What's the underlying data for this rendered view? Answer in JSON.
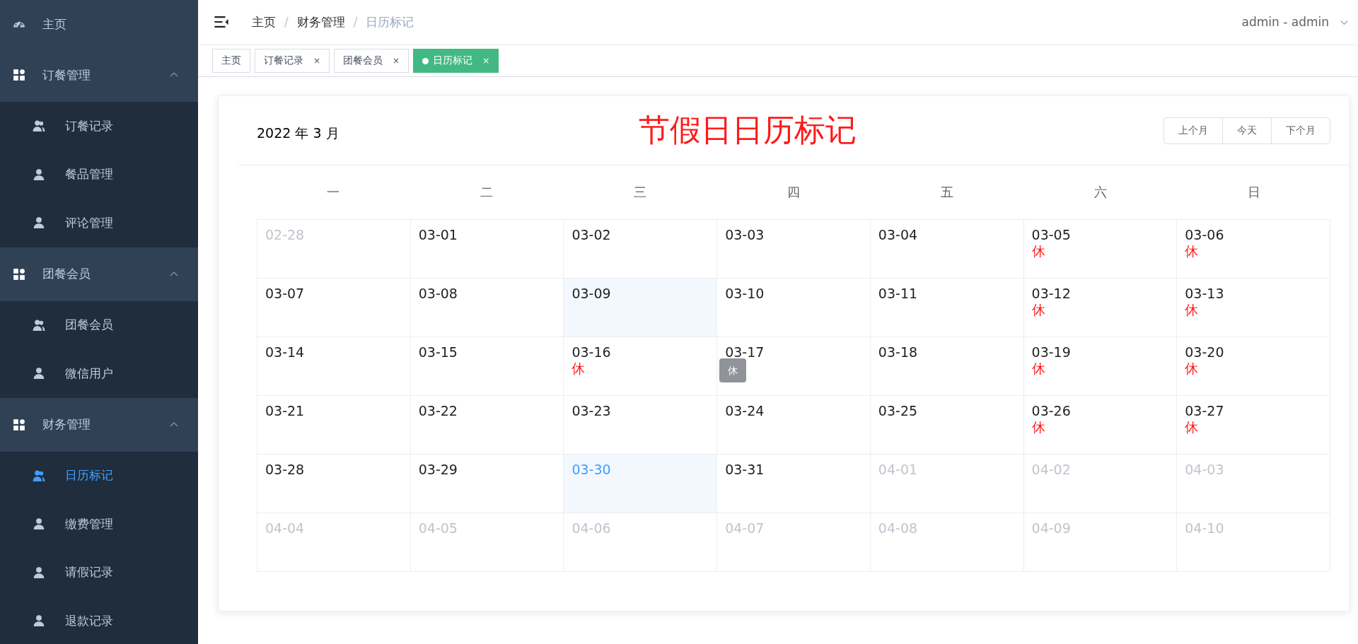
{
  "sidebar": {
    "items": [
      {
        "kind": "link",
        "label": "主页",
        "selected": false
      },
      {
        "kind": "group",
        "label": "订餐管理",
        "expanded": true,
        "children": [
          {
            "kind": "users",
            "label": "订餐记录",
            "selected": false
          },
          {
            "kind": "user",
            "label": "餐品管理",
            "selected": false
          },
          {
            "kind": "user",
            "label": "评论管理",
            "selected": false
          }
        ]
      },
      {
        "kind": "group",
        "label": "团餐会员",
        "expanded": true,
        "children": [
          {
            "kind": "users",
            "label": "团餐会员",
            "selected": false
          },
          {
            "kind": "user",
            "label": "微信用户",
            "selected": false
          }
        ]
      },
      {
        "kind": "group",
        "label": "财务管理",
        "expanded": true,
        "children": [
          {
            "kind": "users",
            "label": "日历标记",
            "selected": true
          },
          {
            "kind": "user",
            "label": "缴费管理",
            "selected": false
          },
          {
            "kind": "user",
            "label": "请假记录",
            "selected": false
          },
          {
            "kind": "user",
            "label": "退款记录",
            "selected": false
          }
        ]
      }
    ]
  },
  "breadcrumb": [
    "主页",
    "财务管理",
    "日历标记"
  ],
  "breadcrumb_separator": "/",
  "user": "admin - admin",
  "tabs": [
    {
      "label": "主页",
      "closable": false,
      "selected": false
    },
    {
      "label": "订餐记录",
      "closable": true,
      "selected": false
    },
    {
      "label": "团餐会员",
      "closable": true,
      "selected": false
    },
    {
      "label": "日历标记",
      "closable": true,
      "selected": true
    }
  ],
  "tab_close": "×",
  "calendar": {
    "month_label": "2022 年 3 月",
    "title": "节假日日历标记",
    "buttons": [
      "上个月",
      "今天",
      "下个月"
    ],
    "weekdays": [
      "一",
      "二",
      "三",
      "四",
      "五",
      "六",
      "日"
    ],
    "weeks": [
      [
        {
          "date": "02-28",
          "in_month": false,
          "highlighted": false,
          "selected": false
        },
        {
          "date": "03-01",
          "in_month": true,
          "highlighted": false,
          "selected": false
        },
        {
          "date": "03-02",
          "in_month": true,
          "highlighted": false,
          "selected": false
        },
        {
          "date": "03-03",
          "in_month": true,
          "highlighted": false,
          "selected": false
        },
        {
          "date": "03-04",
          "in_month": true,
          "highlighted": false,
          "selected": false
        },
        {
          "date": "03-05",
          "in_month": true,
          "highlighted": false,
          "selected": false,
          "note": "休"
        },
        {
          "date": "03-06",
          "in_month": true,
          "highlighted": false,
          "selected": false,
          "note": "休"
        }
      ],
      [
        {
          "date": "03-07",
          "in_month": true,
          "highlighted": false,
          "selected": false
        },
        {
          "date": "03-08",
          "in_month": true,
          "highlighted": false,
          "selected": false
        },
        {
          "date": "03-09",
          "in_month": true,
          "highlighted": true,
          "selected": false
        },
        {
          "date": "03-10",
          "in_month": true,
          "highlighted": false,
          "selected": false
        },
        {
          "date": "03-11",
          "in_month": true,
          "highlighted": false,
          "selected": false
        },
        {
          "date": "03-12",
          "in_month": true,
          "highlighted": false,
          "selected": false,
          "note": "休"
        },
        {
          "date": "03-13",
          "in_month": true,
          "highlighted": false,
          "selected": false,
          "note": "休"
        }
      ],
      [
        {
          "date": "03-14",
          "in_month": true,
          "highlighted": false,
          "selected": false
        },
        {
          "date": "03-15",
          "in_month": true,
          "highlighted": false,
          "selected": false
        },
        {
          "date": "03-16",
          "in_month": true,
          "highlighted": false,
          "selected": false,
          "note": "休"
        },
        {
          "date": "03-17",
          "in_month": true,
          "highlighted": false,
          "selected": false,
          "tooltip": "休"
        },
        {
          "date": "03-18",
          "in_month": true,
          "highlighted": false,
          "selected": false
        },
        {
          "date": "03-19",
          "in_month": true,
          "highlighted": false,
          "selected": false,
          "note": "休"
        },
        {
          "date": "03-20",
          "in_month": true,
          "highlighted": false,
          "selected": false,
          "note": "休"
        }
      ],
      [
        {
          "date": "03-21",
          "in_month": true,
          "highlighted": false,
          "selected": false
        },
        {
          "date": "03-22",
          "in_month": true,
          "highlighted": false,
          "selected": false
        },
        {
          "date": "03-23",
          "in_month": true,
          "highlighted": false,
          "selected": false
        },
        {
          "date": "03-24",
          "in_month": true,
          "highlighted": false,
          "selected": false
        },
        {
          "date": "03-25",
          "in_month": true,
          "highlighted": false,
          "selected": false
        },
        {
          "date": "03-26",
          "in_month": true,
          "highlighted": false,
          "selected": false,
          "note": "休"
        },
        {
          "date": "03-27",
          "in_month": true,
          "highlighted": false,
          "selected": false,
          "note": "休"
        }
      ],
      [
        {
          "date": "03-28",
          "in_month": true,
          "highlighted": false,
          "selected": false
        },
        {
          "date": "03-29",
          "in_month": true,
          "highlighted": false,
          "selected": false
        },
        {
          "date": "03-30",
          "in_month": true,
          "highlighted": false,
          "selected": true
        },
        {
          "date": "03-31",
          "in_month": true,
          "highlighted": false,
          "selected": false
        },
        {
          "date": "04-01",
          "in_month": false,
          "highlighted": false,
          "selected": false
        },
        {
          "date": "04-02",
          "in_month": false,
          "highlighted": false,
          "selected": false
        },
        {
          "date": "04-03",
          "in_month": false,
          "highlighted": false,
          "selected": false
        }
      ],
      [
        {
          "date": "04-04",
          "in_month": false,
          "highlighted": false,
          "selected": false
        },
        {
          "date": "04-05",
          "in_month": false,
          "highlighted": false,
          "selected": false
        },
        {
          "date": "04-06",
          "in_month": false,
          "highlighted": false,
          "selected": false
        },
        {
          "date": "04-07",
          "in_month": false,
          "highlighted": false,
          "selected": false
        },
        {
          "date": "04-08",
          "in_month": false,
          "highlighted": false,
          "selected": false
        },
        {
          "date": "04-09",
          "in_month": false,
          "highlighted": false,
          "selected": false
        },
        {
          "date": "04-10",
          "in_month": false,
          "highlighted": false,
          "selected": false
        }
      ]
    ]
  }
}
